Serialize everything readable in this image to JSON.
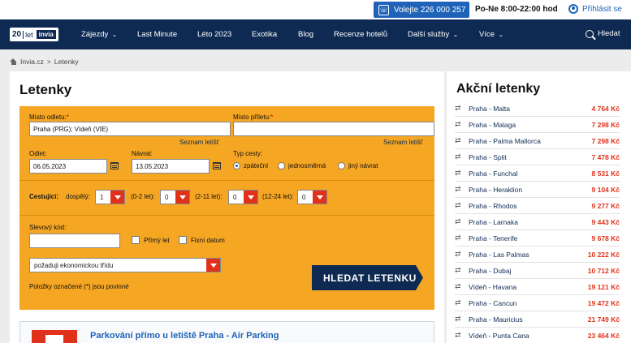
{
  "topbar": {
    "phone_label": "Volejte 226 000 257",
    "phone_icon": "phone-icon",
    "hours": "Po-Ne 8:00-22:00 hod",
    "login": "Přihlásit se"
  },
  "nav": {
    "logo": {
      "number": "20",
      "word": "let",
      "brand": "invia"
    },
    "items": [
      {
        "label": "Zájezdy",
        "dropdown": true
      },
      {
        "label": "Last Minute",
        "dropdown": false
      },
      {
        "label": "Léto 2023",
        "dropdown": false
      },
      {
        "label": "Exotika",
        "dropdown": false
      },
      {
        "label": "Blog",
        "dropdown": false
      },
      {
        "label": "Recenze hotelů",
        "dropdown": false
      },
      {
        "label": "Další služby",
        "dropdown": true
      },
      {
        "label": "Více",
        "dropdown": true
      }
    ],
    "search": "Hledat"
  },
  "breadcrumb": {
    "home": "Invia.cz",
    "separator": ">",
    "current": "Letenky"
  },
  "main": {
    "title": "Letenky",
    "form": {
      "from_label": "Místo odletu:",
      "from_value": "Praha (PRG); Vídeň (VIE)",
      "to_label": "Místo příletu:",
      "to_value": "",
      "req_mark": "*",
      "airports_link": "Seznam letišť",
      "depart_label": "Odlet:",
      "depart_value": "06.05.2023",
      "return_label": "Návrat:",
      "return_value": "13.05.2023",
      "trip_label": "Typ cesty:",
      "trip_options": [
        "zpáteční",
        "jednosměrná",
        "jiný návrat"
      ],
      "trip_selected": "zpáteční",
      "passengers_label": "Cestující:",
      "adults_label": "dospělý:",
      "adults_value": "1",
      "infants_label": "(0-2 let):",
      "infants_value": "0",
      "children_label": "(2-11 let):",
      "children_value": "0",
      "youth_label": "(12-24 let):",
      "youth_value": "0",
      "discount_label": "Slevový kód:",
      "discount_value": "",
      "direct_label": "Přímý let",
      "fixed_label": "Fixní datum",
      "class_value": "požaduji ekonomickou třídu",
      "required_note": "Položky označené (*) jsou povinné",
      "search_button": "HLEDAT LETENKU"
    },
    "promo_title": "Parkování přímo u letiště Praha - Air Parking"
  },
  "side": {
    "title": "Akční letenky",
    "swap_icon": "swap-arrows-icon",
    "deals": [
      {
        "route": "Praha - Malta",
        "price": "4 764 Kč"
      },
      {
        "route": "Praha - Malaga",
        "price": "7 298 Kč"
      },
      {
        "route": "Praha - Palma Mallorca",
        "price": "7 298 Kč"
      },
      {
        "route": "Praha - Split",
        "price": "7 478 Kč"
      },
      {
        "route": "Praha - Funchal",
        "price": "8 531 Kč"
      },
      {
        "route": "Praha - Heraklion",
        "price": "9 104 Kč"
      },
      {
        "route": "Praha - Rhodos",
        "price": "9 277 Kč"
      },
      {
        "route": "Praha - Larnaka",
        "price": "9 443 Kč"
      },
      {
        "route": "Praha - Tenerife",
        "price": "9 678 Kč"
      },
      {
        "route": "Praha - Las Palmas",
        "price": "10 222 Kč"
      },
      {
        "route": "Praha - Dubaj",
        "price": "10 712 Kč"
      },
      {
        "route": "Vídeň - Havana",
        "price": "19 121 Kč"
      },
      {
        "route": "Praha - Cancun",
        "price": "19 472 Kč"
      },
      {
        "route": "Praha - Mauricius",
        "price": "21 749 Kč"
      },
      {
        "route": "Vídeň - Punta Cana",
        "price": "23 464 Kč"
      }
    ]
  },
  "colors": {
    "navy": "#0e2a52",
    "accent_blue": "#1f63b8",
    "form_orange": "#f5a623",
    "price_red": "#e0321b"
  }
}
